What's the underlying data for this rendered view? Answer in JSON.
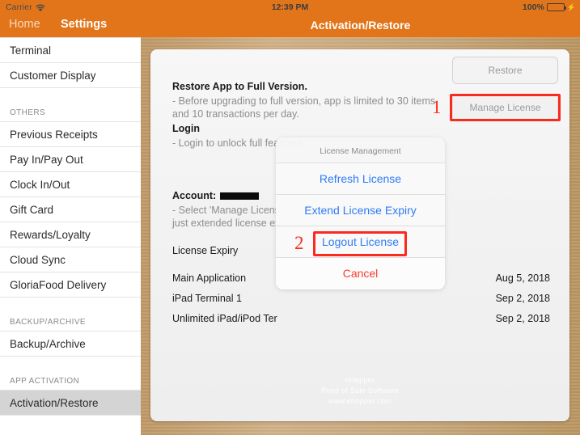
{
  "statusbar": {
    "carrier": "Carrier",
    "wifi_icon": "wifi-icon",
    "time": "12:39 PM",
    "battery_percent": "100%",
    "battery_icon": "battery-full-icon",
    "charging_icon": "lightning-bolt-icon"
  },
  "navbar": {
    "back_label": "Home",
    "section_label": "Settings",
    "title": "Activation/Restore",
    "accent_color": "#e2751a"
  },
  "sidebar": {
    "groups": [
      {
        "header": null,
        "items": [
          {
            "label": "Terminal",
            "selected": false
          },
          {
            "label": "Customer Display",
            "selected": false
          }
        ]
      },
      {
        "header": "OTHERS",
        "items": [
          {
            "label": "Previous Receipts",
            "selected": false
          },
          {
            "label": "Pay In/Pay Out",
            "selected": false
          },
          {
            "label": "Clock In/Out",
            "selected": false
          },
          {
            "label": "Gift Card",
            "selected": false
          },
          {
            "label": "Rewards/Loyalty",
            "selected": false
          },
          {
            "label": "Cloud Sync",
            "selected": false
          },
          {
            "label": "GloriaFood Delivery",
            "selected": false
          }
        ]
      },
      {
        "header": "BACKUP/ARCHIVE",
        "items": [
          {
            "label": "Backup/Archive",
            "selected": false
          }
        ]
      },
      {
        "header": "APP ACTIVATION",
        "items": [
          {
            "label": "Activation/Restore",
            "selected": true
          }
        ]
      }
    ]
  },
  "main": {
    "restore_heading": "Restore App to Full Version.",
    "restore_sub_line1": " - Before upgrading to full version, app is limited to 30 items",
    "restore_sub_line2": "and 10 transactions per day.",
    "login_heading": "Login",
    "login_sub": " - Login to unlock full features.",
    "account_label": "Account:",
    "account_value_redacted": true,
    "account_sub_line1": "- Select 'Manage License'",
    "account_sub_line2": "just extended license exp",
    "license_expiry_label": "License Expiry",
    "rows": [
      {
        "label": "Main Application",
        "date": "Aug 5, 2018"
      },
      {
        "label": "iPad Terminal 1",
        "date": "Sep 2, 2018"
      },
      {
        "label": "Unlimited iPad/iPod Ter",
        "date": "Sep 2, 2018"
      }
    ],
    "restore_button": "Restore",
    "manage_license_button": "Manage License",
    "watermark_line1": "eHopper",
    "watermark_line2": "Point of Sale Software",
    "watermark_line3": "www.ehopper.com"
  },
  "action_sheet": {
    "title": "License Management",
    "options": [
      {
        "label": "Refresh License",
        "style": "default"
      },
      {
        "label": "Extend License Expiry",
        "style": "default"
      },
      {
        "label": "Logout License",
        "style": "default"
      },
      {
        "label": "Cancel",
        "style": "cancel"
      }
    ]
  },
  "annotations": {
    "color": "#fb2a1e",
    "markers": [
      {
        "number": "1",
        "target": "manage-license-button"
      },
      {
        "number": "2",
        "target": "logout-license-option"
      }
    ]
  }
}
